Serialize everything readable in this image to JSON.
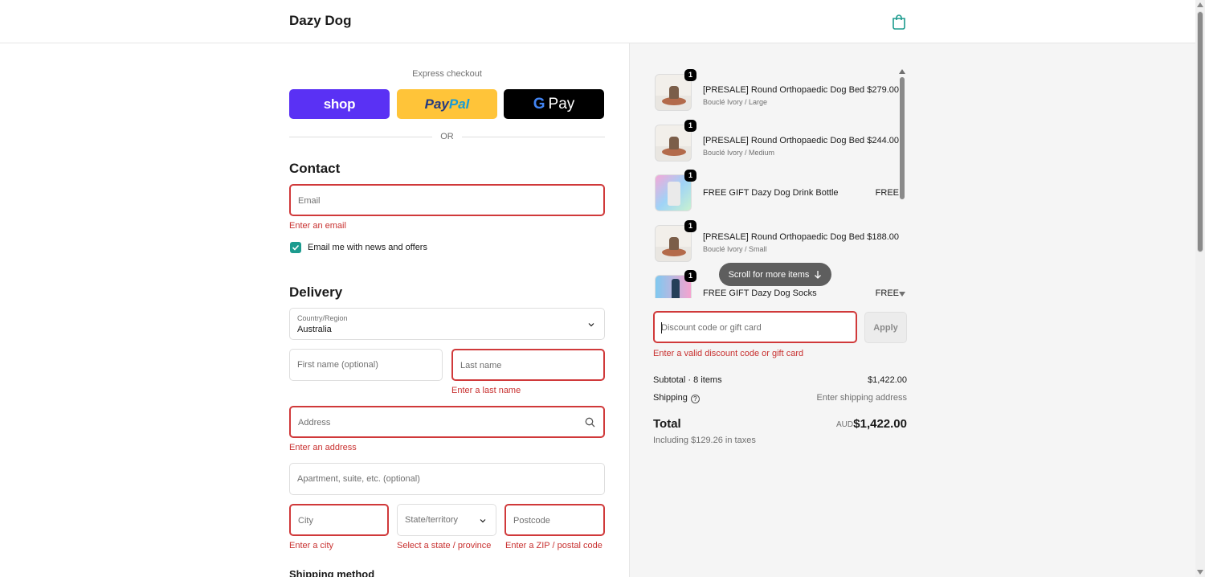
{
  "header": {
    "brand": "Dazy Dog",
    "cart_icon": "shopping-bag-icon"
  },
  "express": {
    "title": "Express checkout",
    "shop_label": "shop",
    "paypal_part1": "Pay",
    "paypal_part2": "Pal",
    "gpay_g": "G",
    "gpay_label": "Pay",
    "or_label": "OR"
  },
  "contact": {
    "title": "Contact",
    "email_placeholder": "Email",
    "email_error": "Enter an email",
    "newsletter_label": "Email me with news and offers",
    "newsletter_checked": true
  },
  "delivery": {
    "title": "Delivery",
    "country_label": "Country/Region",
    "country_value": "Australia",
    "first_name_placeholder": "First name (optional)",
    "last_name_placeholder": "Last name",
    "last_name_error": "Enter a last name",
    "address_placeholder": "Address",
    "address_error": "Enter an address",
    "apartment_placeholder": "Apartment, suite, etc. (optional)",
    "city_placeholder": "City",
    "city_error": "Enter a city",
    "state_placeholder": "State/territory",
    "state_error": "Select a state / province",
    "postcode_placeholder": "Postcode",
    "postcode_error": "Enter a ZIP / postal code",
    "shipping_method_title": "Shipping method"
  },
  "order": {
    "items": [
      {
        "qty": "1",
        "name": "[PRESALE] Round Orthopaedic Dog Bed",
        "variant": "Bouclé Ivory / Large",
        "price": "$279.00"
      },
      {
        "qty": "1",
        "name": "[PRESALE] Round Orthopaedic Dog Bed",
        "variant": "Bouclé Ivory / Medium",
        "price": "$244.00"
      },
      {
        "qty": "1",
        "name": "FREE GIFT Dazy Dog Drink Bottle",
        "variant": "",
        "price": "FREE"
      },
      {
        "qty": "1",
        "name": "[PRESALE] Round Orthopaedic Dog Bed",
        "variant": "Bouclé Ivory / Small",
        "price": "$188.00"
      },
      {
        "qty": "1",
        "name": "FREE GIFT Dazy Dog Socks",
        "variant": "",
        "price": "FREE"
      }
    ],
    "scroll_hint": "Scroll for more items",
    "discount_placeholder": "Discount code or gift card",
    "apply_label": "Apply",
    "discount_error": "Enter a valid discount code or gift card",
    "subtotal_label": "Subtotal · 8 items",
    "subtotal_value": "$1,422.00",
    "shipping_label": "Shipping",
    "shipping_value": "Enter shipping address",
    "total_label": "Total",
    "total_currency": "AUD",
    "total_value": "$1,422.00",
    "taxes_note": "Including $129.26 in taxes"
  },
  "colors": {
    "accent": "#1c9b8e",
    "error": "#c8302f",
    "shop": "#5a31f4",
    "paypal": "#ffc439"
  }
}
